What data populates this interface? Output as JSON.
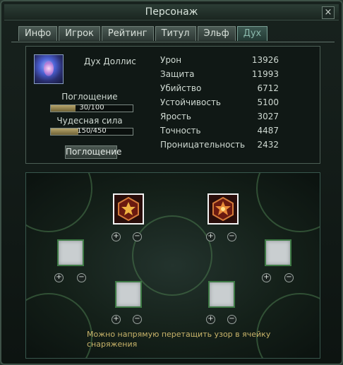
{
  "window": {
    "title": "Персонаж",
    "close": "×"
  },
  "tabs": [
    {
      "label": "Инфо"
    },
    {
      "label": "Игрок"
    },
    {
      "label": "Рейтинг"
    },
    {
      "label": "Титул"
    },
    {
      "label": "Эльф"
    },
    {
      "label": "Дух",
      "active": true
    }
  ],
  "spirit": {
    "name": "Дух Доллис",
    "absorption": {
      "label": "Поглощение",
      "value": "30/100",
      "progress": 0.3
    },
    "power": {
      "label": "Чудесная сила",
      "value": "150/450",
      "progress": 0.333
    },
    "absorb_button": "Поглощение"
  },
  "stats": [
    {
      "name": "Урон",
      "value": "13926"
    },
    {
      "name": "Защита",
      "value": "11993"
    },
    {
      "name": "Убийство",
      "value": "6712"
    },
    {
      "name": "Устойчивость",
      "value": "5100"
    },
    {
      "name": "Ярость",
      "value": "3027"
    },
    {
      "name": "Точность",
      "value": "4487"
    },
    {
      "name": "Проницательность",
      "value": "2432"
    }
  ],
  "equipment": {
    "plus": "+",
    "minus": "−",
    "hint": "Можно напрямую перетащить узор в ячейку снаряжения",
    "colors": {
      "gem_frame": "#f2f2f2",
      "slot_border": "#3e7a45",
      "hint_text": "#c9b46a"
    }
  }
}
